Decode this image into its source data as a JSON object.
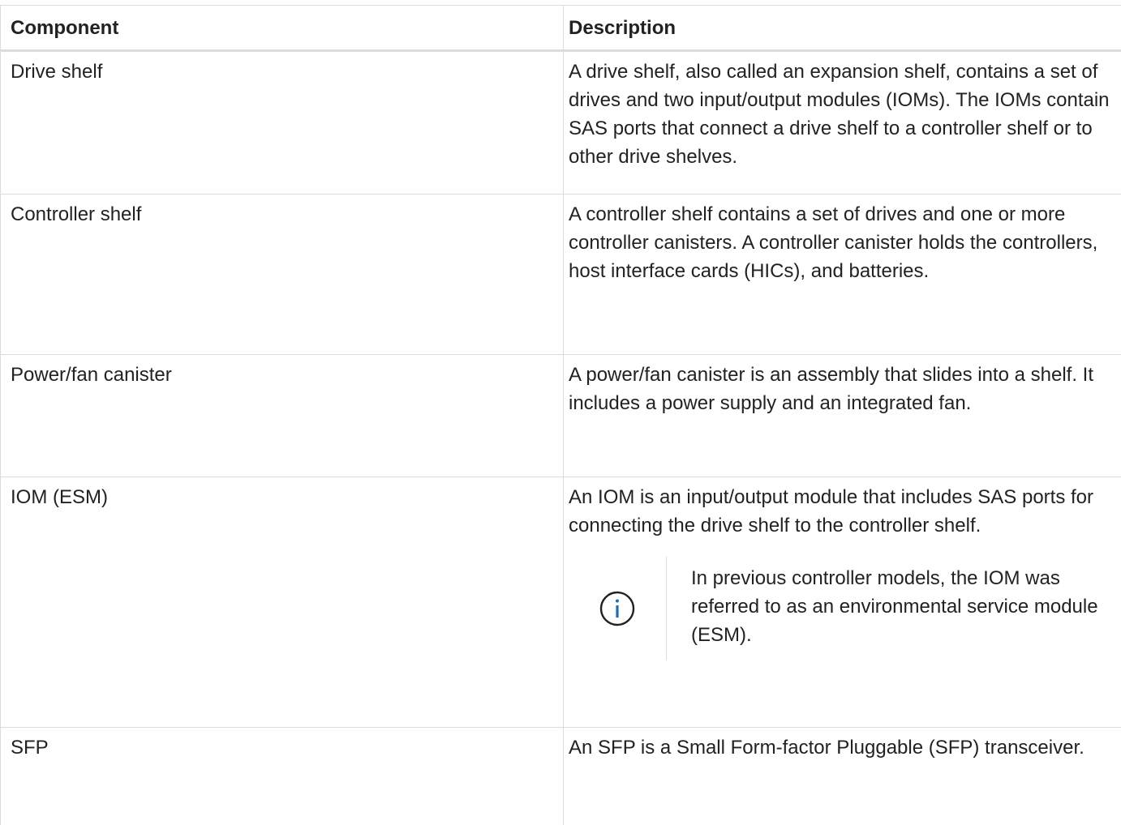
{
  "table": {
    "headers": {
      "component": "Component",
      "description": "Description"
    },
    "rows": [
      {
        "component": "Drive shelf",
        "description": "A drive shelf, also called an expansion shelf, contains a set of drives and two input/output modules (IOMs). The IOMs contain SAS ports that connect a drive shelf to a controller shelf or to other drive shelves."
      },
      {
        "component": "Controller shelf",
        "description": "A controller shelf contains a set of drives and one or more controller canisters. A controller canister holds the controllers, host interface cards (HICs), and batteries."
      },
      {
        "component": "Power/fan canister",
        "description": "A power/fan canister is an assembly that slides into a shelf. It includes a power supply and an integrated fan."
      },
      {
        "component": "IOM (ESM)",
        "description": "An IOM is an input/output module that includes SAS ports for connecting the drive shelf to the controller shelf.",
        "note": {
          "icon": "info-icon",
          "text": "In previous controller models, the IOM was referred to as an environmental service module (ESM)."
        }
      },
      {
        "component": "SFP",
        "description": "An SFP is a Small Form-factor Pluggable (SFP) transceiver."
      }
    ]
  },
  "colors": {
    "text": "#222222",
    "border": "#dcdcdc",
    "info_icon": "#1a6fb5"
  }
}
